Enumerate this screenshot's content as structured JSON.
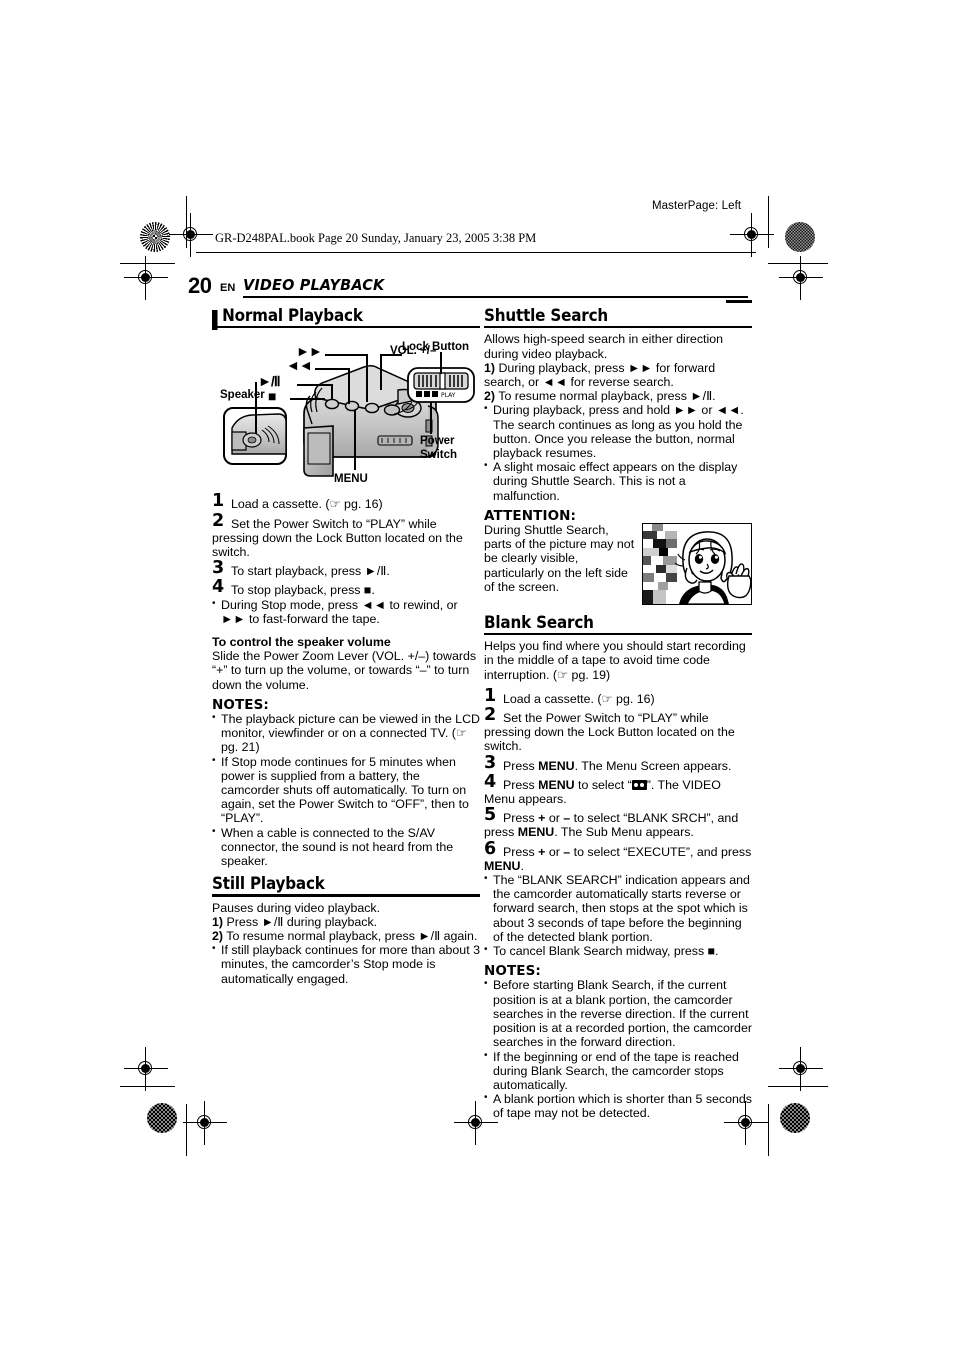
{
  "print_marks": {
    "master_page": "MasterPage: Left",
    "book_line": "GR-D248PAL.book  Page 20  Sunday, January 23, 2005  3:38 PM"
  },
  "header": {
    "page_number": "20",
    "locale": "EN",
    "section_title": "VIDEO PLAYBACK"
  },
  "left_column": {
    "normal_playback": {
      "heading": "Normal Playback",
      "figure": {
        "labels": {
          "ff": "►►",
          "rew": "◄◄",
          "play_pause": "►/Ⅱ",
          "stop": "■",
          "vol": "VOL. +/–",
          "lock_button": "Lock Button",
          "speaker": "Speaker",
          "power_switch_line1": "Power",
          "power_switch_line2": "Switch",
          "menu": "MENU"
        }
      },
      "steps": [
        {
          "n": "1",
          "text": "Load a cassette. (☞ pg. 16)"
        },
        {
          "n": "2",
          "text": "Set the Power Switch to “PLAY” while pressing down the Lock Button located on the switch."
        },
        {
          "n": "3",
          "text": "To start playback, press ►/Ⅱ."
        },
        {
          "n": "4",
          "text": "To stop playback, press ■."
        }
      ],
      "step4_bullet": "During Stop mode, press ◄◄ to rewind, or ►► to fast-forward the tape.",
      "volume_subheading": "To control the speaker volume",
      "volume_text": "Slide the Power Zoom Lever (VOL. +/–) towards “+” to turn up the volume, or towards “–” to turn down the volume.",
      "notes_label": "NOTES:",
      "notes": [
        "The playback picture can be viewed in the LCD monitor, viewfinder or on a connected TV. (☞ pg. 21)",
        "If Stop mode continues for 5 minutes when power is supplied from a battery, the camcorder shuts off automatically. To turn on again, set the Power Switch to “OFF”, then to “PLAY”.",
        "When a cable is connected to the S/AV connector, the sound is not heard from the speaker."
      ]
    },
    "still_playback": {
      "heading": "Still Playback",
      "intro": "Pauses during video playback.",
      "numbered": [
        {
          "n": "1)",
          "text": "Press ►/Ⅱ during playback."
        },
        {
          "n": "2)",
          "text": "To resume normal playback, press ►/Ⅱ again."
        }
      ],
      "bullets": [
        "If still playback continues for more than about 3 minutes, the camcorder’s Stop mode is automatically engaged."
      ]
    }
  },
  "right_column": {
    "shuttle_search": {
      "heading": "Shuttle Search",
      "intro": "Allows high-speed search in either direction during video playback.",
      "numbered": [
        {
          "n": "1)",
          "text": "During playback, press ►► for forward search, or ◄◄ for reverse search."
        },
        {
          "n": "2)",
          "text": "To resume normal playback, press ►/Ⅱ."
        }
      ],
      "bullets": [
        "During playback, press and hold ►► or ◄◄. The search continues as long as you hold the button. Once you release the button, normal playback resumes.",
        "A slight mosaic effect appears on the display during Shuttle Search. This is not a malfunction."
      ],
      "attention_label": "ATTENTION:",
      "attention_text": "During Shuttle Search, parts of the picture may not be clearly visible, particularly on the left side of the screen."
    },
    "blank_search": {
      "heading": "Blank Search",
      "intro": "Helps you find where you should start recording in the middle of a tape to avoid time code interruption. (☞ pg. 19)",
      "steps": [
        {
          "n": "1",
          "text": "Load a cassette. (☞ pg. 16)"
        },
        {
          "n": "2",
          "text": "Set the Power Switch to “PLAY” while pressing down the Lock Button located on the switch."
        },
        {
          "n": "3",
          "text": "Press MENU. The Menu Screen appears."
        },
        {
          "n": "4",
          "text": "Press MENU to select “■”. The VIDEO Menu appears."
        },
        {
          "n": "5",
          "text": "Press + or – to select “BLANK SRCH”, and press MENU. The Sub Menu appears."
        },
        {
          "n": "6",
          "text": "Press + or – to select “EXECUTE”, and press MENU."
        }
      ],
      "bullets": [
        "The “BLANK SEARCH” indication appears and the camcorder automatically starts reverse or forward search, then stops at the spot which is about 3 seconds of tape before the beginning of the detected blank portion.",
        "To cancel Blank Search midway, press ■."
      ],
      "notes_label": "NOTES:",
      "notes": [
        "Before starting Blank Search, if the current position is at a blank portion, the camcorder searches in the reverse direction. If the current position is at a recorded portion, the camcorder searches in the forward direction.",
        "If the beginning or end of the tape is reached during Blank Search, the camcorder stops automatically.",
        "A blank portion which is shorter than 5 seconds of tape may not be detected."
      ]
    }
  }
}
